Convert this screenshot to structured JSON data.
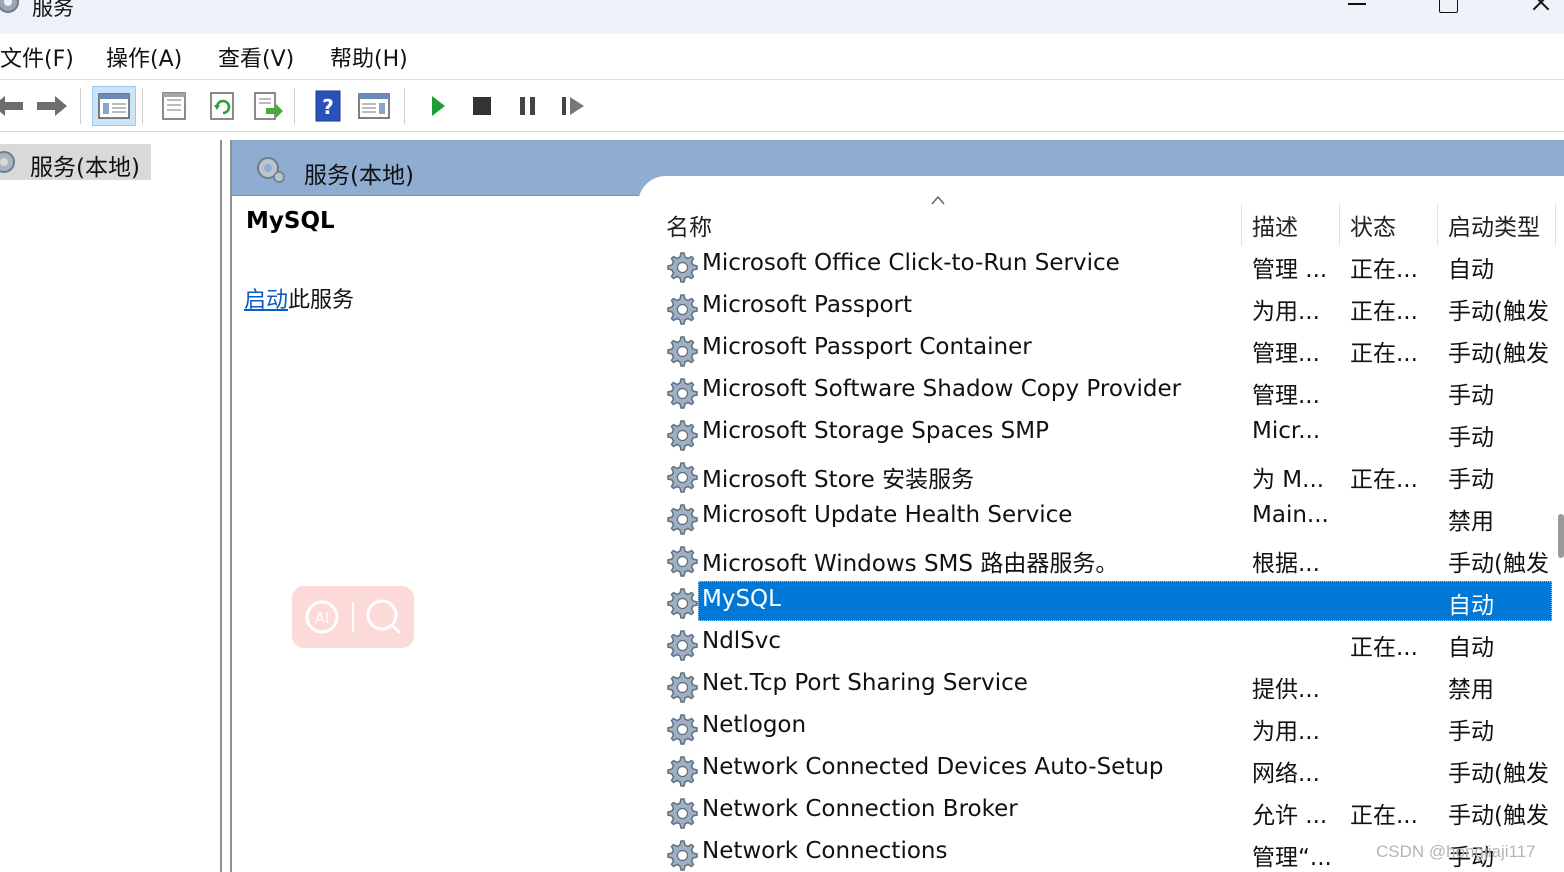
{
  "window": {
    "title": "服务"
  },
  "menu": [
    "文件(F)",
    "操作(A)",
    "查看(V)",
    "帮助(H)"
  ],
  "toolbar": {
    "icons": [
      "back-arrow-icon",
      "forward-arrow-icon",
      "show-hide-console-tree-icon",
      "properties-icon",
      "refresh-icon",
      "export-list-icon",
      "help-icon",
      "show-action-pane-icon",
      "start-service-icon",
      "stop-service-icon",
      "pause-service-icon",
      "restart-service-icon"
    ],
    "colors": {
      "play": "#1e9e3a",
      "stop": "#333333",
      "help": "#2a52be"
    }
  },
  "tree": {
    "root_label": "服务(本地)"
  },
  "pane": {
    "header_title": "服务(本地)",
    "selected_service_name": "MySQL",
    "action_link": "启动",
    "action_suffix": "此服务"
  },
  "columns": {
    "name": "名称",
    "description": "描述",
    "status": "状态",
    "startup": "启动类型"
  },
  "services": [
    {
      "name": "Microsoft Office Click-to-Run Service",
      "description": "管理 ...",
      "status": "正在...",
      "startup": "自动"
    },
    {
      "name": "Microsoft Passport",
      "description": "为用...",
      "status": "正在...",
      "startup": "手动(触发"
    },
    {
      "name": "Microsoft Passport Container",
      "description": "管理...",
      "status": "正在...",
      "startup": "手动(触发"
    },
    {
      "name": "Microsoft Software Shadow Copy Provider",
      "description": "管理...",
      "status": "",
      "startup": "手动"
    },
    {
      "name": "Microsoft Storage Spaces SMP",
      "description": "Micr...",
      "status": "",
      "startup": "手动"
    },
    {
      "name": "Microsoft Store 安装服务",
      "description": "为 M...",
      "status": "正在...",
      "startup": "手动"
    },
    {
      "name": "Microsoft Update Health Service",
      "description": "Main...",
      "status": "",
      "startup": "禁用"
    },
    {
      "name": "Microsoft Windows SMS 路由器服务。",
      "description": "根据...",
      "status": "",
      "startup": "手动(触发"
    },
    {
      "name": "MySQL",
      "description": "",
      "status": "",
      "startup": "自动",
      "selected": true
    },
    {
      "name": "NdlSvc",
      "description": "",
      "status": "正在...",
      "startup": "自动"
    },
    {
      "name": "Net.Tcp Port Sharing Service",
      "description": "提供...",
      "status": "",
      "startup": "禁用"
    },
    {
      "name": "Netlogon",
      "description": "为用...",
      "status": "",
      "startup": "手动"
    },
    {
      "name": "Network Connected Devices Auto-Setup",
      "description": "网络...",
      "status": "",
      "startup": "手动(触发"
    },
    {
      "name": "Network Connection Broker",
      "description": "允许 ...",
      "status": "正在...",
      "startup": "手动(触发"
    },
    {
      "name": "Network Connections",
      "description": "管理“...",
      "status": "",
      "startup": "手动"
    }
  ],
  "watermark": "CSDN @hongjiaji117"
}
